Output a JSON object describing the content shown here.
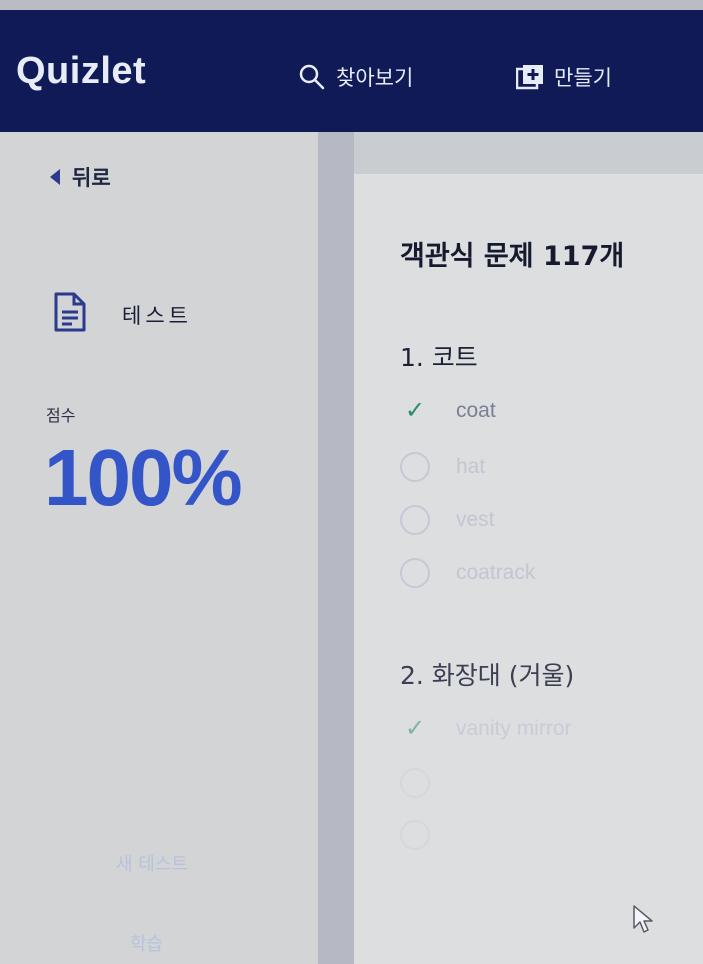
{
  "header": {
    "logo": "Quizlet",
    "search_label": "찾아보기",
    "create_label": "만들기"
  },
  "sidebar": {
    "back_label": "뒤로",
    "mode_label": "테스트",
    "score_label": "점수",
    "score_value": "100%",
    "retake_label": "새 테스트",
    "review_label": "학습"
  },
  "main": {
    "title": "객관식 문제 117개",
    "questions": [
      {
        "number_title": "1. 코트",
        "options": [
          {
            "text": "coat",
            "state": "correct"
          },
          {
            "text": "hat",
            "state": "unselected"
          },
          {
            "text": "vest",
            "state": "unselected"
          },
          {
            "text": "coatrack",
            "state": "unselected"
          }
        ]
      },
      {
        "number_title": "2. 화장대 (거울)",
        "options": [
          {
            "text": "vanity mirror",
            "state": "correct"
          }
        ]
      }
    ]
  },
  "colors": {
    "header_bg": "#0f1a57",
    "score_blue": "#3355c8",
    "check_green": "#2f8a6a"
  }
}
